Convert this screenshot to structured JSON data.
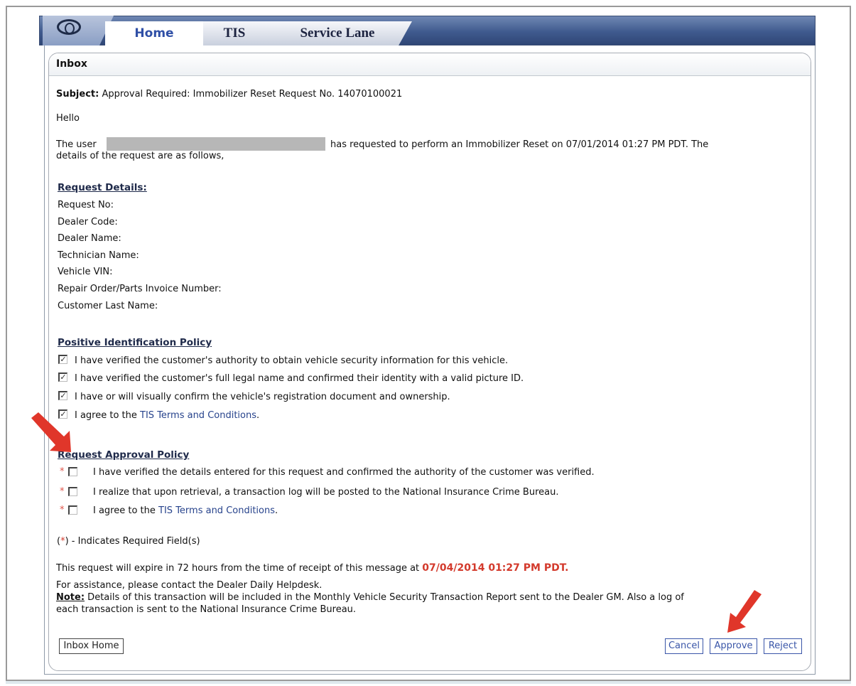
{
  "tabs": [
    {
      "label": "Home"
    },
    {
      "label": "TIS"
    },
    {
      "label": "Service Lane"
    }
  ],
  "inbox": {
    "title": "Inbox",
    "subject_label": "Subject:",
    "subject_value": "Approval Required: Immobilizer Reset Request No. 14070100021",
    "greeting": "Hello",
    "body_line1_a": "The user",
    "body_line1_b": "has requested to perform an Immobilizer Reset on 07/01/2014 01:27 PM PDT. The",
    "body_line2": "details of the request are as follows,"
  },
  "request_details": {
    "title": "Request Details:",
    "fields": [
      "Request No:",
      "Dealer Code:",
      "Dealer Name:",
      "Technician Name:",
      "Vehicle VIN:",
      "Repair Order/Parts Invoice Number:",
      "Customer Last Name:"
    ]
  },
  "positive_id_policy": {
    "title": "Positive Identification Policy",
    "items": [
      {
        "text": "I have verified the customer's authority to obtain vehicle security information for this vehicle.",
        "checked": true
      },
      {
        "text": "I have verified the customer's full legal name and confirmed their identity with a valid picture ID.",
        "checked": true
      },
      {
        "text": "I have or will visually confirm the vehicle's registration document and ownership.",
        "checked": true
      },
      {
        "text_prefix": "I agree to the ",
        "link": "TIS Terms and Conditions",
        "text_suffix": ".",
        "checked": true
      }
    ]
  },
  "approval_policy": {
    "title": "Request Approval Policy",
    "required_mark": "*",
    "items": [
      {
        "text": "I have verified the details entered for this request and confirmed the authority of the customer was verified.",
        "checked": false
      },
      {
        "text": "I realize that upon retrieval, a transaction log will be posted to the National Insurance Crime Bureau.",
        "checked": false
      },
      {
        "text_prefix": "I agree to the ",
        "link": "TIS Terms and Conditions",
        "text_suffix": ".",
        "checked": false
      }
    ]
  },
  "required_note": {
    "prefix": "(",
    "star": "*",
    "suffix": ") - Indicates Required Field(s)"
  },
  "expiry": {
    "text": "This request will expire in 72 hours from the time of receipt of this message at ",
    "datetime": "07/04/2014 01:27 PM PDT."
  },
  "assistance": "For assistance, please contact the Dealer Daily Helpdesk.",
  "note": {
    "label": "Note:",
    "line1": " Details of this transaction will be included in the Monthly Vehicle Security Transaction Report sent to the Dealer GM. Also a log of",
    "line2": "each transaction is sent to the National Insurance Crime Bureau."
  },
  "buttons": {
    "inbox_home": "Inbox Home",
    "cancel": "Cancel",
    "approve": "Approve",
    "reject": "Reject"
  },
  "colors": {
    "link": "#27438c",
    "required": "#e0554a",
    "expiry": "#d33a2c",
    "arrow": "#e0362a"
  }
}
